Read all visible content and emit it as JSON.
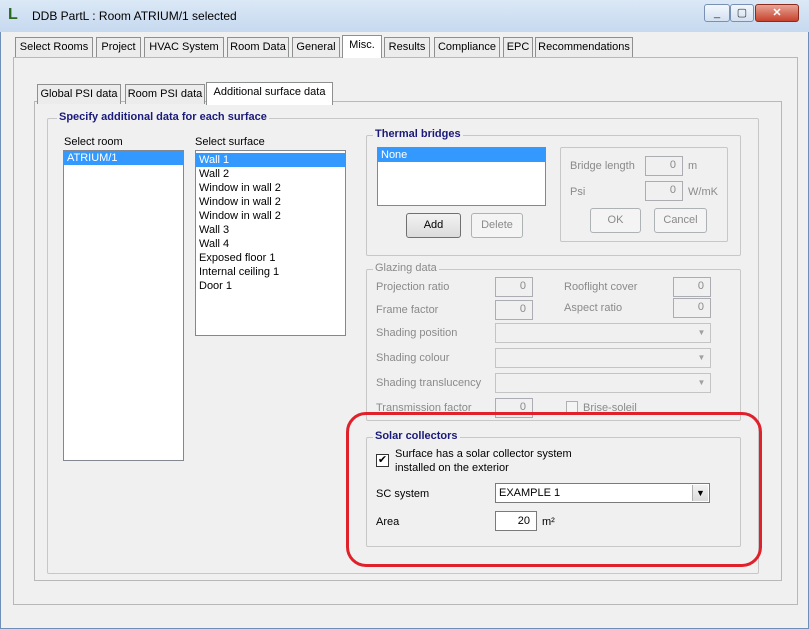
{
  "window": {
    "title": "DDB PartL : Room ATRIUM/1 selected",
    "icon": "app-logo-icon"
  },
  "main_tabs": [
    "Select Rooms",
    "Project",
    "HVAC System",
    "Room Data",
    "General",
    "Misc.",
    "Results",
    "Compliance",
    "EPC",
    "Recommendations"
  ],
  "sub_tabs": [
    "Global PSI data",
    "Room PSI data",
    "Additional surface data"
  ],
  "section_title": "Specify additional data for each surface",
  "select_room": {
    "label": "Select room",
    "items": [
      "ATRIUM/1"
    ]
  },
  "select_surface": {
    "label": "Select surface",
    "items": [
      "Wall  1",
      "Wall  2",
      "Window in wall  2",
      "Window in wall  2",
      "Window in wall  2",
      "Wall  3",
      "Wall  4",
      "Exposed floor  1",
      "Internal ceiling  1",
      "Door  1"
    ]
  },
  "thermal_bridges": {
    "title": "Thermal bridges",
    "items": [
      "None"
    ],
    "add_label": "Add",
    "delete_label": "Delete",
    "bridge_length_label": "Bridge length",
    "bridge_length_value": "0",
    "bridge_length_unit": "m",
    "psi_label": "Psi",
    "psi_value": "0",
    "psi_unit": "W/mK",
    "ok_label": "OK",
    "cancel_label": "Cancel"
  },
  "glazing": {
    "title": "Glazing data",
    "projection_ratio_label": "Projection ratio",
    "projection_ratio_value": "0",
    "rooflight_cover_label": "Rooflight cover",
    "rooflight_cover_value": "0",
    "frame_factor_label": "Frame factor",
    "frame_factor_value": "0",
    "aspect_ratio_label": "Aspect ratio",
    "aspect_ratio_value": "0",
    "shading_position_label": "Shading position",
    "shading_colour_label": "Shading colour",
    "shading_translucency_label": "Shading translucency",
    "transmission_factor_label": "Transmission factor",
    "transmission_factor_value": "0",
    "brise_soleil_label": "Brise-soleil"
  },
  "solar": {
    "title": "Solar collectors",
    "checkbox_label_1": "Surface has a solar collector system",
    "checkbox_label_2": "installed on the exterior",
    "checked": true,
    "sc_system_label": "SC system",
    "sc_system_value": "EXAMPLE 1",
    "area_label": "Area",
    "area_value": "20",
    "area_unit": "m²"
  },
  "colors": {
    "highlight": "#e0202a",
    "selection": "#3399ff",
    "group_title": "#1a1a7a"
  }
}
